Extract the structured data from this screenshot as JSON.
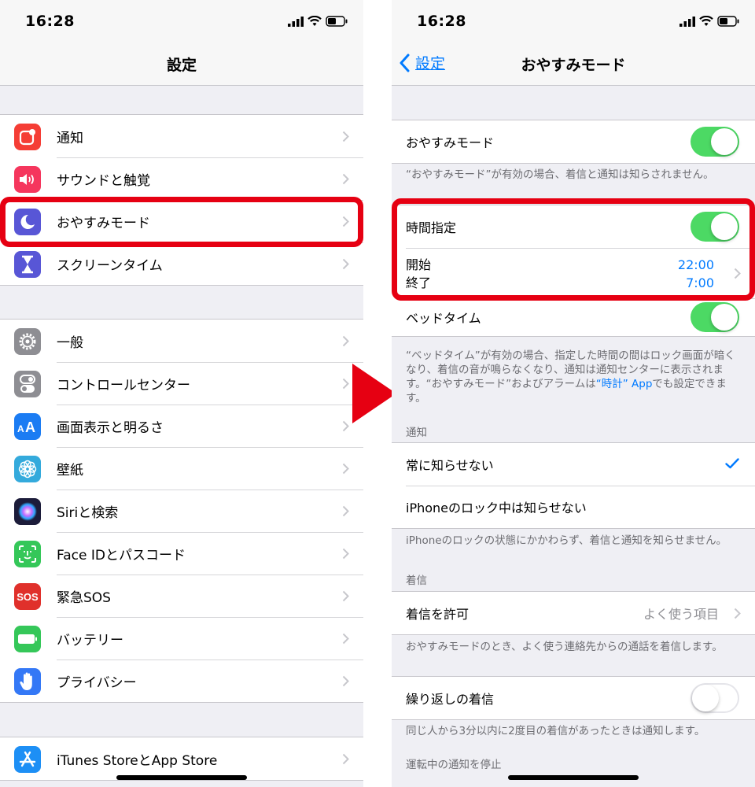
{
  "status_bar": {
    "time": "16:28"
  },
  "left_screen": {
    "nav_title": "設定",
    "groups": [
      {
        "items": [
          {
            "label": "通知",
            "icon": "notifications-icon",
            "color": "#f53d35"
          },
          {
            "label": "サウンドと触覚",
            "icon": "speaker-icon",
            "color": "#f5365d"
          },
          {
            "label": "おやすみモード",
            "icon": "moon-icon",
            "color": "#5856d6"
          },
          {
            "label": "スクリーンタイム",
            "icon": "hourglass-icon",
            "color": "#5856d6"
          }
        ]
      },
      {
        "items": [
          {
            "label": "一般",
            "icon": "gear-icon",
            "color": "#8e8e93"
          },
          {
            "label": "コントロールセンター",
            "icon": "toggles-icon",
            "color": "#8e8e93"
          },
          {
            "label": "画面表示と明るさ",
            "icon": "text-size-icon",
            "color": "#1b7cf3"
          },
          {
            "label": "壁紙",
            "icon": "flower-icon",
            "color": "#34aadc"
          },
          {
            "label": "Siriと検索",
            "icon": "siri-icon",
            "color": "#1c1c3a"
          },
          {
            "label": "Face IDとパスコード",
            "icon": "face-id-icon",
            "color": "#35c759"
          },
          {
            "label": "緊急SOS",
            "icon": "sos-icon",
            "color": "#e0302b",
            "icon_text": "SOS"
          },
          {
            "label": "バッテリー",
            "icon": "battery-icon",
            "color": "#35c759"
          },
          {
            "label": "プライバシー",
            "icon": "hand-icon",
            "color": "#3478f6"
          }
        ]
      },
      {
        "items": [
          {
            "label": "iTunes StoreとApp Store",
            "icon": "app-store-icon",
            "color": "#1d8ff5"
          }
        ]
      }
    ]
  },
  "right_screen": {
    "back_label": "設定",
    "nav_title": "おやすみモード",
    "dnd": {
      "label": "おやすみモード",
      "on": true
    },
    "dnd_footer": "“おやすみモード”が有効の場合、着信と通知は知らされません。",
    "scheduled": {
      "label": "時間指定",
      "on": true
    },
    "start_label": "開始",
    "end_label": "終了",
    "start_time": "22:00",
    "end_time": "7:00",
    "bedtime": {
      "label": "ベッドタイム",
      "on": true
    },
    "bedtime_footer_a": "“ベッドタイム”が有効の場合、指定した時間の間はロック画面が暗くなり、着信の音が鳴らなくなり、通知は通知センターに表示されます。“おやすみモード”およびアラームは",
    "bedtime_footer_link": "“時計” App",
    "bedtime_footer_b": "でも設定できます。",
    "notify_header": "通知",
    "always_label": "常に知らせない",
    "locked_label": "iPhoneのロック中は知らせない",
    "notify_footer": "iPhoneのロックの状態にかかわらず、着信と通知を知らせません。",
    "calls_header": "着信",
    "allow_calls_label": "着信を許可",
    "allow_calls_value": "よく使う項目",
    "calls_footer": "おやすみモードのとき、よく使う連絡先からの通話を着信します。",
    "repeated": {
      "label": "繰り返しの着信",
      "on": false
    },
    "repeated_footer": "同じ人から3分以内に2度目の着信があったときは通知します。",
    "driving_header": "運転中の通知を停止"
  },
  "colors": {
    "highlight": "#e60012",
    "accent": "#007aff",
    "switch_on": "#4cd964"
  }
}
